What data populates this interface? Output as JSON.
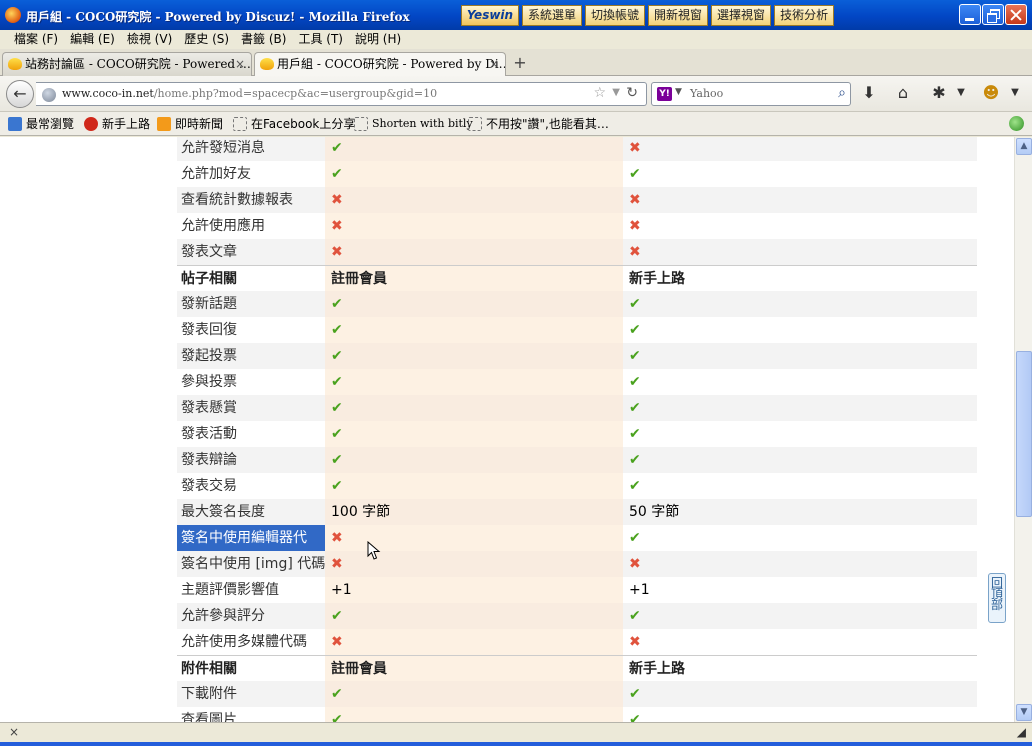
{
  "window": {
    "title": "用戶組 - COCO研究院 - Powered by Discuz! - Mozilla Firefox",
    "extension_logo": "Yeswin",
    "extension_buttons": [
      "系統選單",
      "切換帳號",
      "開新視窗",
      "選擇視窗",
      "技術分析"
    ]
  },
  "menu": [
    "檔案 (F)",
    "編輯 (E)",
    "檢視 (V)",
    "歷史 (S)",
    "書籤 (B)",
    "工具 (T)",
    "說明 (H)"
  ],
  "tabs": [
    {
      "label": "站務討論區 - COCO研究院 - Powered …",
      "close": "×"
    },
    {
      "label": "用戶組 - COCO研究院 - Powered by Di…",
      "close": "×"
    }
  ],
  "newtab": "+",
  "nav": {
    "url_domain": "www.coco-in.net",
    "url_path": "/home.php?mod=spacecp&ac=usergroup&gid=10",
    "search_engine_badge": "Y!",
    "search_placeholder": "Yahoo"
  },
  "bookmarks": [
    "最常瀏覽",
    "新手上路",
    "即時新聞",
    "在Facebook上分享",
    "Shorten with bitly",
    "不用按\"讚\",也能看其…"
  ],
  "table": {
    "rows": [
      {
        "label": "允許發短消息",
        "reg": "yes",
        "new": "no"
      },
      {
        "label": "允許加好友",
        "reg": "yes",
        "new": "yes"
      },
      {
        "label": "查看統計數據報表",
        "reg": "no",
        "new": "no"
      },
      {
        "label": "允許使用應用",
        "reg": "no",
        "new": "no"
      },
      {
        "label": "發表文章",
        "reg": "no",
        "new": "no"
      },
      {
        "header": true,
        "label": "帖子相關",
        "reg": "註冊會員",
        "new": "新手上路"
      },
      {
        "label": "發新話題",
        "reg": "yes",
        "new": "yes"
      },
      {
        "label": "發表回復",
        "reg": "yes",
        "new": "yes"
      },
      {
        "label": "發起投票",
        "reg": "yes",
        "new": "yes"
      },
      {
        "label": "參與投票",
        "reg": "yes",
        "new": "yes"
      },
      {
        "label": "發表懸賞",
        "reg": "yes",
        "new": "yes"
      },
      {
        "label": "發表活動",
        "reg": "yes",
        "new": "yes"
      },
      {
        "label": "發表辯論",
        "reg": "yes",
        "new": "yes"
      },
      {
        "label": "發表交易",
        "reg": "yes",
        "new": "yes"
      },
      {
        "label": "最大簽名長度",
        "reg": "100 字節",
        "new": "50 字節"
      },
      {
        "label": "簽名中使用編輯器代",
        "reg": "no",
        "new": "yes",
        "selected": true
      },
      {
        "label": "簽名中使用 [img] 代碼",
        "reg": "no",
        "new": "no"
      },
      {
        "label": "主題評價影響值",
        "reg": "+1",
        "new": "+1"
      },
      {
        "label": "允許參與評分",
        "reg": "yes",
        "new": "yes"
      },
      {
        "label": "允許使用多媒體代碼",
        "reg": "no",
        "new": "no"
      },
      {
        "header": true,
        "label": "附件相關",
        "reg": "註冊會員",
        "new": "新手上路"
      },
      {
        "label": "下載附件",
        "reg": "yes",
        "new": "yes"
      },
      {
        "label": "查看圖片",
        "reg": "yes",
        "new": "yes"
      }
    ]
  },
  "back_to_top": "回頂部",
  "status": {
    "close": "×"
  }
}
